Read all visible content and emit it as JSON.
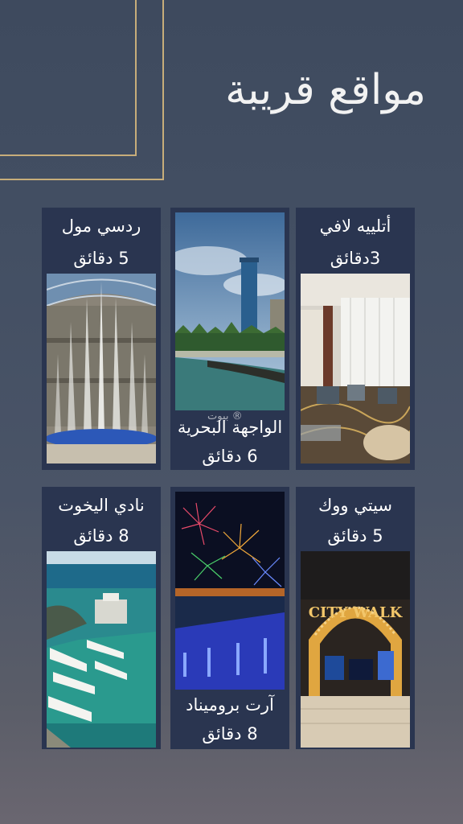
{
  "header": {
    "title": "مواقع قريبة"
  },
  "watermark": "بيوت ®",
  "locations": [
    {
      "name": "أتلييه لافي",
      "time": "3دقائق"
    },
    {
      "name": "الواجهة البحرية",
      "time": "6 دقائق"
    },
    {
      "name": "ردسي مول",
      "time": "5 دقائق"
    },
    {
      "name": "سيتي ووك",
      "time": "5 دقائق"
    },
    {
      "name": "آرت بروميناد",
      "time": "8 دقائق"
    },
    {
      "name": "نادي اليخوت",
      "time": "8 دقائق"
    }
  ]
}
